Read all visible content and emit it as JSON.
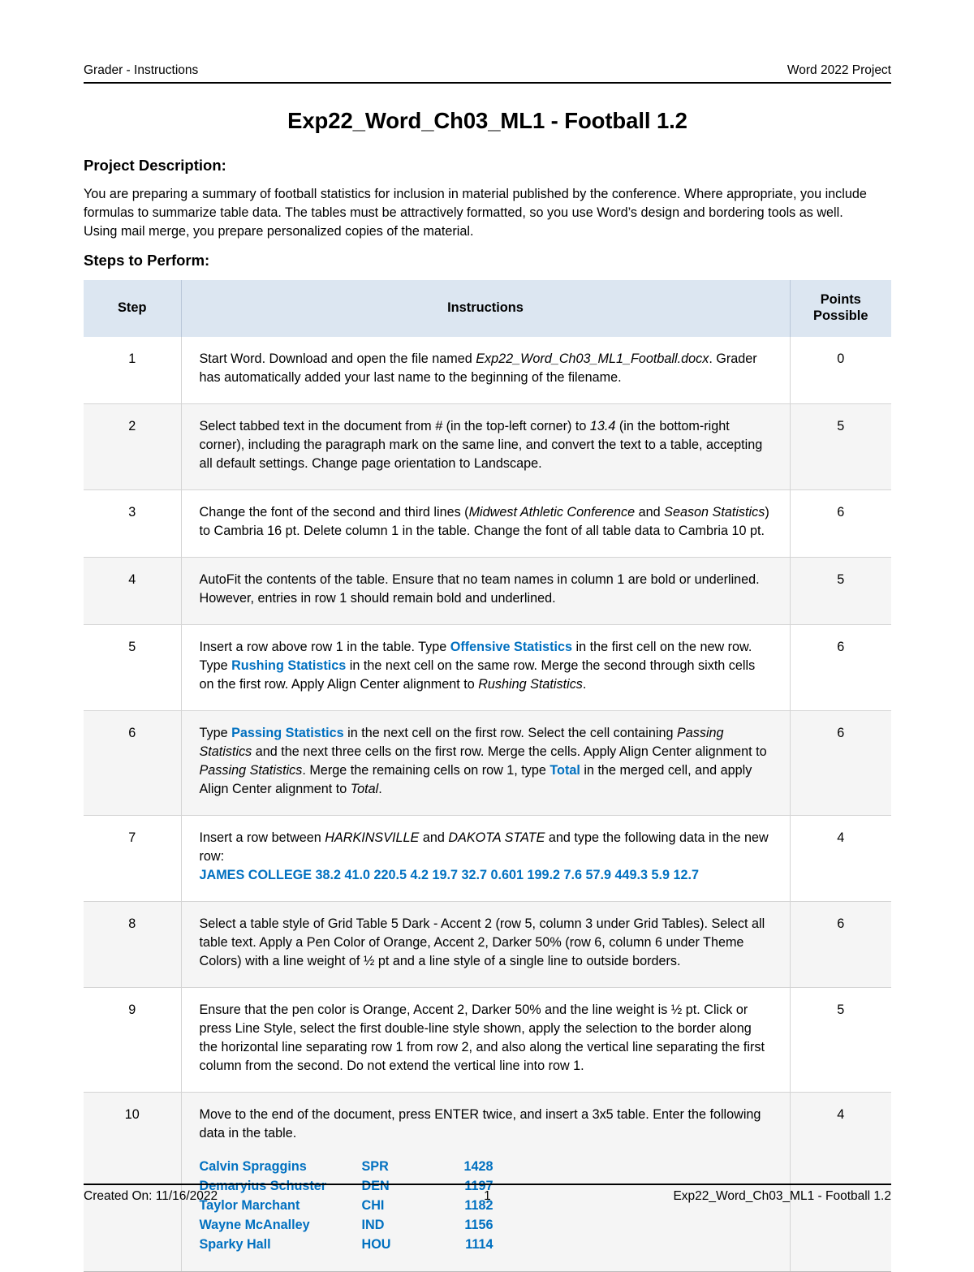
{
  "header": {
    "left": "Grader - Instructions",
    "right": "Word 2022 Project"
  },
  "title": "Exp22_Word_Ch03_ML1 - Football 1.2",
  "project_description": {
    "heading": "Project Description:",
    "body": "You are preparing a summary of football statistics for inclusion in material published by the conference. Where appropriate, you include formulas to summarize table data. The tables must be attractively formatted, so you use Word’s design and bordering tools as well. Using mail merge, you prepare personalized copies of the material."
  },
  "steps_section": {
    "heading": "Steps to Perform:"
  },
  "table": {
    "columns": [
      "Step",
      "Instructions",
      "Points Possible"
    ],
    "column_headers": {
      "step": "Step",
      "instructions": "Instructions",
      "points_line1": "Points",
      "points_line2": "Possible"
    },
    "accent_color": "#0070c0",
    "header_background": "#dce6f1",
    "rows": [
      {
        "step": "1",
        "points": "0",
        "segments": [
          {
            "text": "Start Word. Download and open the file named ",
            "style": "normal"
          },
          {
            "text": "Exp22_Word_Ch03_ML1_Football.docx",
            "style": "italic"
          },
          {
            "text": ". Grader has automatically added your last name to the beginning of the filename.",
            "style": "normal"
          }
        ]
      },
      {
        "step": "2",
        "points": "5",
        "segments": [
          {
            "text": "Select tabbed text in the document from ",
            "style": "normal"
          },
          {
            "text": "#",
            "style": "italic"
          },
          {
            "text": " (in the top-left corner) to ",
            "style": "normal"
          },
          {
            "text": "13.4",
            "style": "italic"
          },
          {
            "text": " (in the bottom-right corner), including the paragraph mark on the same line, and convert the text to a table, accepting all default settings. Change page orientation to Landscape.",
            "style": "normal"
          }
        ]
      },
      {
        "step": "3",
        "points": "6",
        "segments": [
          {
            "text": "Change the font of the second and third lines (",
            "style": "normal"
          },
          {
            "text": "Midwest Athletic Conference",
            "style": "italic"
          },
          {
            "text": " and ",
            "style": "normal"
          },
          {
            "text": "Season Statistics",
            "style": "italic"
          },
          {
            "text": ") to Cambria 16 pt. Delete column 1 in the table. Change the font of all table data to Cambria 10 pt.",
            "style": "normal"
          }
        ]
      },
      {
        "step": "4",
        "points": "5",
        "segments": [
          {
            "text": "AutoFit the contents of the table. Ensure that no team names in column 1 are bold or underlined. However, entries in row 1 should remain bold and underlined.",
            "style": "normal"
          }
        ]
      },
      {
        "step": "5",
        "points": "6",
        "segments": [
          {
            "text": "Insert a row above row 1 in the table. Type ",
            "style": "normal"
          },
          {
            "text": "Offensive Statistics",
            "style": "blue"
          },
          {
            "text": " in the first cell on the new row. Type ",
            "style": "normal"
          },
          {
            "text": "Rushing Statistics",
            "style": "blue"
          },
          {
            "text": " in the next cell on the same row.  Merge the second through sixth cells on the first row. Apply Align Center alignment to ",
            "style": "normal"
          },
          {
            "text": "Rushing Statistics",
            "style": "italic"
          },
          {
            "text": ".",
            "style": "normal"
          }
        ]
      },
      {
        "step": "6",
        "points": "6",
        "segments": [
          {
            "text": "Type ",
            "style": "normal"
          },
          {
            "text": "Passing Statistics",
            "style": "blue"
          },
          {
            "text": " in the next cell on the first row. Select the cell containing ",
            "style": "normal"
          },
          {
            "text": "Passing Statistics",
            "style": "italic"
          },
          {
            "text": " and the next three cells on the first row. Merge the cells. Apply Align Center alignment to ",
            "style": "normal"
          },
          {
            "text": "Passing Statistics",
            "style": "italic"
          },
          {
            "text": ". Merge the remaining cells on row 1, type ",
            "style": "normal"
          },
          {
            "text": "Total",
            "style": "blue"
          },
          {
            "text": " in the merged cell, and apply Align Center alignment to ",
            "style": "normal"
          },
          {
            "text": "Total",
            "style": "italic"
          },
          {
            "text": ".",
            "style": "normal"
          }
        ]
      },
      {
        "step": "7",
        "points": "4",
        "segments": [
          {
            "text": "Insert a row between ",
            "style": "normal"
          },
          {
            "text": "HARKINSVILLE",
            "style": "italic"
          },
          {
            "text": " and ",
            "style": "normal"
          },
          {
            "text": "DAKOTA STATE",
            "style": "italic"
          },
          {
            "text": " and type the following data in the new row:",
            "style": "normal"
          }
        ],
        "data_line": "JAMES COLLEGE   38.2   41.0   220.5   4.2   19.7   32.7   0.601   199.2   7.6   57.9   449.3   5.9   12.7"
      },
      {
        "step": "8",
        "points": "6",
        "segments": [
          {
            "text": "Select a table style of Grid Table 5 Dark - Accent 2 (row 5, column 3 under Grid Tables). Select all table text. Apply a Pen Color of Orange, Accent 2, Darker 50% (row 6, column 6 under Theme Colors) with a line weight of ½ pt and a line style of a single line to outside borders.",
            "style": "normal"
          }
        ]
      },
      {
        "step": "9",
        "points": "5",
        "segments": [
          {
            "text": "Ensure that the pen color is Orange, Accent 2, Darker 50% and the line weight is ½ pt. Click or press Line Style, select the first double-line style shown, apply the selection to the border along the horizontal line separating row 1 from row 2, and also along the vertical line separating the first column from the second. Do not extend the vertical line into row 1.",
            "style": "normal"
          }
        ]
      },
      {
        "step": "10",
        "points": "4",
        "segments": [
          {
            "text": "Move to the end of the document, press ENTER twice, and insert a 3x5 table. Enter the following data in the table.",
            "style": "normal"
          }
        ],
        "data_table": {
          "rows": [
            [
              "Calvin Spraggins",
              "SPR",
              "1428"
            ],
            [
              "Demaryius Schuster",
              "DEN",
              "1197"
            ],
            [
              "Taylor Marchant",
              "CHI",
              "1182"
            ],
            [
              "Wayne McAnalley",
              "IND",
              "1156"
            ],
            [
              "Sparky Hall",
              "HOU",
              "1114"
            ]
          ]
        }
      }
    ]
  },
  "footer": {
    "left": "Created On: 11/16/2022",
    "center": "1",
    "right": "Exp22_Word_Ch03_ML1 - Football 1.2"
  }
}
